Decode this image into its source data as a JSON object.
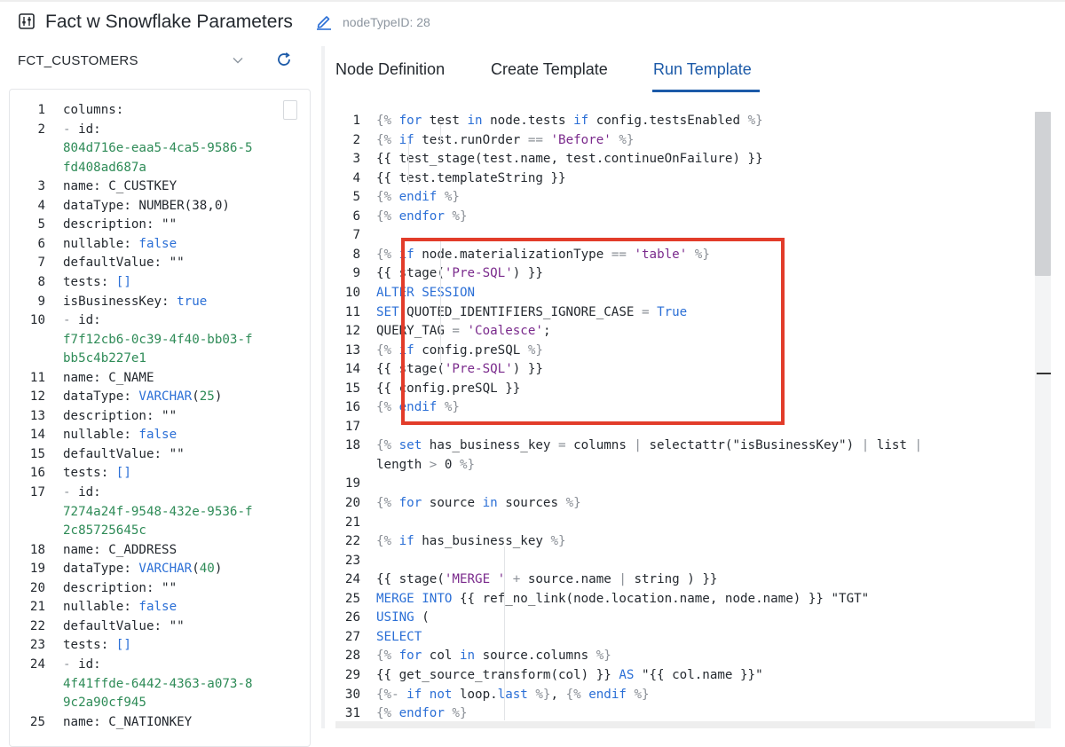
{
  "header": {
    "title": "Fact w Snowflake Parameters",
    "node_type_id": "nodeTypeID: 28"
  },
  "left_panel": {
    "node_name": "FCT_CUSTOMERS"
  },
  "tabs": [
    {
      "label": "Node Definition",
      "active": false
    },
    {
      "label": "Create Template",
      "active": false
    },
    {
      "label": "Run Template",
      "active": true
    }
  ],
  "colors": {
    "accent": "#1c5aa8",
    "highlight_border": "#e23c2a",
    "keyword": "#2b6fd6",
    "string": "#7a2a8c",
    "hex": "#2e8b57"
  },
  "yaml_lines": [
    {
      "n": "1",
      "segs": [
        [
          "p",
          "columns:"
        ]
      ]
    },
    {
      "n": "2",
      "segs": [
        [
          "d",
          "  - "
        ],
        [
          "p",
          "id:"
        ]
      ]
    },
    {
      "n": "",
      "segs": [
        [
          "h",
          "804d716e-eaa5-4ca5-9586-5"
        ]
      ]
    },
    {
      "n": "",
      "segs": [
        [
          "h",
          "fd408ad687a"
        ]
      ]
    },
    {
      "n": "3",
      "segs": [
        [
          "p",
          "    name: C_CUSTKEY"
        ]
      ]
    },
    {
      "n": "4",
      "segs": [
        [
          "p",
          "    dataType: NUMBER(38,0)"
        ]
      ]
    },
    {
      "n": "5",
      "segs": [
        [
          "p",
          "    description: \"\""
        ]
      ]
    },
    {
      "n": "6",
      "segs": [
        [
          "p",
          "    nullable: "
        ],
        [
          "k",
          "false"
        ]
      ]
    },
    {
      "n": "7",
      "segs": [
        [
          "p",
          "    defaultValue: \"\""
        ]
      ]
    },
    {
      "n": "8",
      "segs": [
        [
          "p",
          "    tests: "
        ],
        [
          "k",
          "[]"
        ]
      ]
    },
    {
      "n": "9",
      "segs": [
        [
          "p",
          "    isBusinessKey: "
        ],
        [
          "k",
          "true"
        ]
      ]
    },
    {
      "n": "10",
      "segs": [
        [
          "d",
          "  - "
        ],
        [
          "p",
          "id:"
        ]
      ]
    },
    {
      "n": "",
      "segs": [
        [
          "h",
          "f7f12cb6-0c39-4f40-bb03-f"
        ]
      ]
    },
    {
      "n": "",
      "segs": [
        [
          "h",
          "bb5c4b227e1"
        ]
      ]
    },
    {
      "n": "11",
      "segs": [
        [
          "p",
          "    name: C_NAME"
        ]
      ]
    },
    {
      "n": "12",
      "segs": [
        [
          "p",
          "    dataType: "
        ],
        [
          "k",
          "VARCHAR"
        ],
        [
          "p",
          "("
        ],
        [
          "h",
          "25"
        ],
        [
          "p",
          ")"
        ]
      ]
    },
    {
      "n": "13",
      "segs": [
        [
          "p",
          "    description: \"\""
        ]
      ]
    },
    {
      "n": "14",
      "segs": [
        [
          "p",
          "    nullable: "
        ],
        [
          "k",
          "false"
        ]
      ]
    },
    {
      "n": "15",
      "segs": [
        [
          "p",
          "    defaultValue: \"\""
        ]
      ]
    },
    {
      "n": "16",
      "segs": [
        [
          "p",
          "    tests: "
        ],
        [
          "k",
          "[]"
        ]
      ]
    },
    {
      "n": "17",
      "segs": [
        [
          "d",
          "  - "
        ],
        [
          "p",
          "id:"
        ]
      ]
    },
    {
      "n": "",
      "segs": [
        [
          "h",
          "7274a24f-9548-432e-9536-f"
        ]
      ]
    },
    {
      "n": "",
      "segs": [
        [
          "h",
          "2c85725645c"
        ]
      ]
    },
    {
      "n": "18",
      "segs": [
        [
          "p",
          "    name: C_ADDRESS"
        ]
      ]
    },
    {
      "n": "19",
      "segs": [
        [
          "p",
          "    dataType: "
        ],
        [
          "k",
          "VARCHAR"
        ],
        [
          "p",
          "("
        ],
        [
          "h",
          "40"
        ],
        [
          "p",
          ")"
        ]
      ]
    },
    {
      "n": "20",
      "segs": [
        [
          "p",
          "    description: \"\""
        ]
      ]
    },
    {
      "n": "21",
      "segs": [
        [
          "p",
          "    nullable: "
        ],
        [
          "k",
          "false"
        ]
      ]
    },
    {
      "n": "22",
      "segs": [
        [
          "p",
          "    defaultValue: \"\""
        ]
      ]
    },
    {
      "n": "23",
      "segs": [
        [
          "p",
          "    tests: "
        ],
        [
          "k",
          "[]"
        ]
      ]
    },
    {
      "n": "24",
      "segs": [
        [
          "d",
          "  - "
        ],
        [
          "p",
          "id:"
        ]
      ]
    },
    {
      "n": "",
      "segs": [
        [
          "h",
          "4f41ffde-6442-4363-a073-8"
        ]
      ]
    },
    {
      "n": "",
      "segs": [
        [
          "h",
          "9c2a90cf945"
        ]
      ]
    },
    {
      "n": "25",
      "segs": [
        [
          "p",
          "    name: C_NATIONKEY"
        ]
      ]
    }
  ],
  "template_lines": [
    {
      "n": "1",
      "segs": [
        [
          "d",
          "{% "
        ],
        [
          "k",
          "for"
        ],
        [
          "p",
          " test "
        ],
        [
          "k",
          "in"
        ],
        [
          "p",
          " node.tests "
        ],
        [
          "k",
          "if"
        ],
        [
          "p",
          " config.testsEnabled "
        ],
        [
          "d",
          "%}"
        ]
      ]
    },
    {
      "n": "2",
      "segs": [
        [
          "p",
          "          "
        ],
        [
          "d",
          "{% "
        ],
        [
          "k",
          "if"
        ],
        [
          "p",
          " test.runOrder "
        ],
        [
          "d",
          "=="
        ],
        [
          "p",
          " "
        ],
        [
          "s",
          "'Before'"
        ],
        [
          "p",
          " "
        ],
        [
          "d",
          "%}"
        ]
      ]
    },
    {
      "n": "3",
      "segs": [
        [
          "p",
          "               {{ test_stage(test.name, test.continueOnFailure) }}"
        ]
      ]
    },
    {
      "n": "4",
      "segs": [
        [
          "p",
          "               {{ test.templateString }}"
        ]
      ]
    },
    {
      "n": "5",
      "segs": [
        [
          "p",
          "          "
        ],
        [
          "d",
          "{% "
        ],
        [
          "k",
          "endif"
        ],
        [
          "p",
          " "
        ],
        [
          "d",
          "%}"
        ]
      ]
    },
    {
      "n": "6",
      "segs": [
        [
          "p",
          "     "
        ],
        [
          "d",
          "{% "
        ],
        [
          "k",
          "endfor"
        ],
        [
          "p",
          " "
        ],
        [
          "d",
          "%}"
        ]
      ]
    },
    {
      "n": "7",
      "segs": [
        [
          "p",
          ""
        ]
      ]
    },
    {
      "n": "8",
      "segs": [
        [
          "p",
          "     "
        ],
        [
          "d",
          "{% "
        ],
        [
          "k",
          "if"
        ],
        [
          "p",
          " node.materializationType "
        ],
        [
          "d",
          "=="
        ],
        [
          "p",
          " "
        ],
        [
          "s",
          "'table'"
        ],
        [
          "p",
          " "
        ],
        [
          "d",
          "%}"
        ]
      ]
    },
    {
      "n": "9",
      "segs": [
        [
          "p",
          "         {{ stage("
        ],
        [
          "s",
          "'Pre-SQL'"
        ],
        [
          "p",
          ") }}"
        ]
      ]
    },
    {
      "n": "10",
      "segs": [
        [
          "p",
          "          "
        ],
        [
          "k",
          "ALTER SESSION"
        ]
      ]
    },
    {
      "n": "11",
      "segs": [
        [
          "p",
          "          "
        ],
        [
          "k",
          "SET"
        ],
        [
          "p",
          " QUOTED_IDENTIFIERS_IGNORE_CASE "
        ],
        [
          "d",
          "="
        ],
        [
          "p",
          " "
        ],
        [
          "k",
          "True"
        ]
      ]
    },
    {
      "n": "12",
      "segs": [
        [
          "p",
          "          QUERY_TAG "
        ],
        [
          "d",
          "="
        ],
        [
          "p",
          " "
        ],
        [
          "s",
          "'Coalesce'"
        ],
        [
          "p",
          ";"
        ]
      ]
    },
    {
      "n": "13",
      "segs": [
        [
          "p",
          "          "
        ],
        [
          "d",
          "{% "
        ],
        [
          "k",
          "if"
        ],
        [
          "p",
          " config.preSQL "
        ],
        [
          "d",
          "%}"
        ]
      ]
    },
    {
      "n": "14",
      "segs": [
        [
          "p",
          "               {{ stage("
        ],
        [
          "s",
          "'Pre-SQL'"
        ],
        [
          "p",
          ") }}"
        ]
      ]
    },
    {
      "n": "15",
      "segs": [
        [
          "p",
          "               {{ config.preSQL }}"
        ]
      ]
    },
    {
      "n": "16",
      "segs": [
        [
          "p",
          "          "
        ],
        [
          "d",
          "{% "
        ],
        [
          "k",
          "endif"
        ],
        [
          "p",
          " "
        ],
        [
          "d",
          "%}"
        ]
      ]
    },
    {
      "n": "17",
      "segs": [
        [
          "p",
          ""
        ]
      ]
    },
    {
      "n": "18",
      "segs": [
        [
          "p",
          "          "
        ],
        [
          "d",
          "{% "
        ],
        [
          "k",
          "set"
        ],
        [
          "p",
          " has_business_key "
        ],
        [
          "d",
          "="
        ],
        [
          "p",
          " columns "
        ],
        [
          "d",
          "|"
        ],
        [
          "p",
          " selectattr(\"isBusinessKey\") "
        ],
        [
          "d",
          "|"
        ],
        [
          "p",
          " list "
        ],
        [
          "d",
          "|"
        ]
      ]
    },
    {
      "n": "",
      "segs": [
        [
          "p",
          "          length "
        ],
        [
          "d",
          ">"
        ],
        [
          "p",
          " 0 "
        ],
        [
          "d",
          "%}"
        ]
      ]
    },
    {
      "n": "19",
      "segs": [
        [
          "p",
          ""
        ]
      ]
    },
    {
      "n": "20",
      "segs": [
        [
          "p",
          "          "
        ],
        [
          "d",
          "{% "
        ],
        [
          "k",
          "for"
        ],
        [
          "p",
          " source "
        ],
        [
          "k",
          "in"
        ],
        [
          "p",
          " sources "
        ],
        [
          "d",
          "%}"
        ]
      ]
    },
    {
      "n": "21",
      "segs": [
        [
          "p",
          ""
        ]
      ]
    },
    {
      "n": "22",
      "segs": [
        [
          "p",
          "               "
        ],
        [
          "d",
          "{% "
        ],
        [
          "k",
          "if"
        ],
        [
          "p",
          " has_business_key "
        ],
        [
          "d",
          "%}"
        ]
      ]
    },
    {
      "n": "23",
      "segs": [
        [
          "p",
          ""
        ]
      ]
    },
    {
      "n": "24",
      "segs": [
        [
          "p",
          "                    {{ stage("
        ],
        [
          "s",
          "'MERGE '"
        ],
        [
          "p",
          " "
        ],
        [
          "d",
          "+"
        ],
        [
          "p",
          " source.name "
        ],
        [
          "d",
          "|"
        ],
        [
          "p",
          " string ) }}"
        ]
      ]
    },
    {
      "n": "25",
      "segs": [
        [
          "p",
          "                    "
        ],
        [
          "k",
          "MERGE INTO"
        ],
        [
          "p",
          " {{ ref_no_link(node.location.name, node.name) }} \"TGT\""
        ]
      ]
    },
    {
      "n": "26",
      "segs": [
        [
          "p",
          "                    "
        ],
        [
          "k",
          "USING"
        ],
        [
          "p",
          " ("
        ]
      ]
    },
    {
      "n": "27",
      "segs": [
        [
          "p",
          "                         "
        ],
        [
          "k",
          "SELECT"
        ]
      ]
    },
    {
      "n": "28",
      "segs": [
        [
          "p",
          "                         "
        ],
        [
          "d",
          "{% "
        ],
        [
          "k",
          "for"
        ],
        [
          "p",
          " col "
        ],
        [
          "k",
          "in"
        ],
        [
          "p",
          " source.columns "
        ],
        [
          "d",
          "%}"
        ]
      ]
    },
    {
      "n": "29",
      "segs": [
        [
          "p",
          "                              {{ get_source_transform(col) }} "
        ],
        [
          "k",
          "AS"
        ],
        [
          "p",
          " \"{{ col.name }}\""
        ]
      ]
    },
    {
      "n": "30",
      "segs": [
        [
          "p",
          "                              "
        ],
        [
          "d",
          "{%- "
        ],
        [
          "k",
          "if not"
        ],
        [
          "p",
          " loop."
        ],
        [
          "k",
          "last"
        ],
        [
          "p",
          " "
        ],
        [
          "d",
          "%}"
        ],
        [
          "p",
          ", "
        ],
        [
          "d",
          "{% "
        ],
        [
          "k",
          "endif"
        ],
        [
          "p",
          " "
        ],
        [
          "d",
          "%}"
        ]
      ]
    },
    {
      "n": "31",
      "segs": [
        [
          "p",
          "                         "
        ],
        [
          "d",
          "{% "
        ],
        [
          "k",
          "endfor"
        ],
        [
          "p",
          " "
        ],
        [
          "d",
          "%}"
        ]
      ]
    }
  ]
}
